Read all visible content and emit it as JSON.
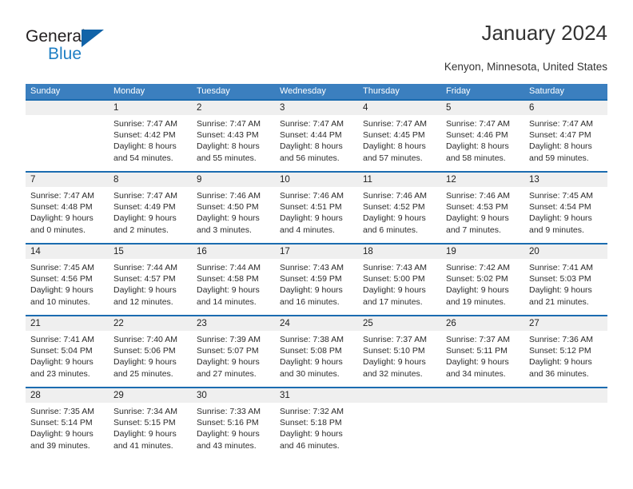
{
  "brand": {
    "name_part1": "General",
    "name_part2": "Blue"
  },
  "header": {
    "title": "January 2024",
    "location": "Kenyon, Minnesota, United States"
  },
  "colors": {
    "header_blue": "#3b7fbf",
    "separator_blue": "#1b6cb0",
    "date_band_gray": "#efefef",
    "brand_blue": "#1f7fc4",
    "logo_triangle": "#1163a8",
    "text": "#2b2b2b"
  },
  "calendar": {
    "day_names": [
      "Sunday",
      "Monday",
      "Tuesday",
      "Wednesday",
      "Thursday",
      "Friday",
      "Saturday"
    ],
    "weeks": [
      [
        {
          "day": "",
          "lines": []
        },
        {
          "day": "1",
          "lines": [
            "Sunrise: 7:47 AM",
            "Sunset: 4:42 PM",
            "Daylight: 8 hours",
            "and 54 minutes."
          ]
        },
        {
          "day": "2",
          "lines": [
            "Sunrise: 7:47 AM",
            "Sunset: 4:43 PM",
            "Daylight: 8 hours",
            "and 55 minutes."
          ]
        },
        {
          "day": "3",
          "lines": [
            "Sunrise: 7:47 AM",
            "Sunset: 4:44 PM",
            "Daylight: 8 hours",
            "and 56 minutes."
          ]
        },
        {
          "day": "4",
          "lines": [
            "Sunrise: 7:47 AM",
            "Sunset: 4:45 PM",
            "Daylight: 8 hours",
            "and 57 minutes."
          ]
        },
        {
          "day": "5",
          "lines": [
            "Sunrise: 7:47 AM",
            "Sunset: 4:46 PM",
            "Daylight: 8 hours",
            "and 58 minutes."
          ]
        },
        {
          "day": "6",
          "lines": [
            "Sunrise: 7:47 AM",
            "Sunset: 4:47 PM",
            "Daylight: 8 hours",
            "and 59 minutes."
          ]
        }
      ],
      [
        {
          "day": "7",
          "lines": [
            "Sunrise: 7:47 AM",
            "Sunset: 4:48 PM",
            "Daylight: 9 hours",
            "and 0 minutes."
          ]
        },
        {
          "day": "8",
          "lines": [
            "Sunrise: 7:47 AM",
            "Sunset: 4:49 PM",
            "Daylight: 9 hours",
            "and 2 minutes."
          ]
        },
        {
          "day": "9",
          "lines": [
            "Sunrise: 7:46 AM",
            "Sunset: 4:50 PM",
            "Daylight: 9 hours",
            "and 3 minutes."
          ]
        },
        {
          "day": "10",
          "lines": [
            "Sunrise: 7:46 AM",
            "Sunset: 4:51 PM",
            "Daylight: 9 hours",
            "and 4 minutes."
          ]
        },
        {
          "day": "11",
          "lines": [
            "Sunrise: 7:46 AM",
            "Sunset: 4:52 PM",
            "Daylight: 9 hours",
            "and 6 minutes."
          ]
        },
        {
          "day": "12",
          "lines": [
            "Sunrise: 7:46 AM",
            "Sunset: 4:53 PM",
            "Daylight: 9 hours",
            "and 7 minutes."
          ]
        },
        {
          "day": "13",
          "lines": [
            "Sunrise: 7:45 AM",
            "Sunset: 4:54 PM",
            "Daylight: 9 hours",
            "and 9 minutes."
          ]
        }
      ],
      [
        {
          "day": "14",
          "lines": [
            "Sunrise: 7:45 AM",
            "Sunset: 4:56 PM",
            "Daylight: 9 hours",
            "and 10 minutes."
          ]
        },
        {
          "day": "15",
          "lines": [
            "Sunrise: 7:44 AM",
            "Sunset: 4:57 PM",
            "Daylight: 9 hours",
            "and 12 minutes."
          ]
        },
        {
          "day": "16",
          "lines": [
            "Sunrise: 7:44 AM",
            "Sunset: 4:58 PM",
            "Daylight: 9 hours",
            "and 14 minutes."
          ]
        },
        {
          "day": "17",
          "lines": [
            "Sunrise: 7:43 AM",
            "Sunset: 4:59 PM",
            "Daylight: 9 hours",
            "and 16 minutes."
          ]
        },
        {
          "day": "18",
          "lines": [
            "Sunrise: 7:43 AM",
            "Sunset: 5:00 PM",
            "Daylight: 9 hours",
            "and 17 minutes."
          ]
        },
        {
          "day": "19",
          "lines": [
            "Sunrise: 7:42 AM",
            "Sunset: 5:02 PM",
            "Daylight: 9 hours",
            "and 19 minutes."
          ]
        },
        {
          "day": "20",
          "lines": [
            "Sunrise: 7:41 AM",
            "Sunset: 5:03 PM",
            "Daylight: 9 hours",
            "and 21 minutes."
          ]
        }
      ],
      [
        {
          "day": "21",
          "lines": [
            "Sunrise: 7:41 AM",
            "Sunset: 5:04 PM",
            "Daylight: 9 hours",
            "and 23 minutes."
          ]
        },
        {
          "day": "22",
          "lines": [
            "Sunrise: 7:40 AM",
            "Sunset: 5:06 PM",
            "Daylight: 9 hours",
            "and 25 minutes."
          ]
        },
        {
          "day": "23",
          "lines": [
            "Sunrise: 7:39 AM",
            "Sunset: 5:07 PM",
            "Daylight: 9 hours",
            "and 27 minutes."
          ]
        },
        {
          "day": "24",
          "lines": [
            "Sunrise: 7:38 AM",
            "Sunset: 5:08 PM",
            "Daylight: 9 hours",
            "and 30 minutes."
          ]
        },
        {
          "day": "25",
          "lines": [
            "Sunrise: 7:37 AM",
            "Sunset: 5:10 PM",
            "Daylight: 9 hours",
            "and 32 minutes."
          ]
        },
        {
          "day": "26",
          "lines": [
            "Sunrise: 7:37 AM",
            "Sunset: 5:11 PM",
            "Daylight: 9 hours",
            "and 34 minutes."
          ]
        },
        {
          "day": "27",
          "lines": [
            "Sunrise: 7:36 AM",
            "Sunset: 5:12 PM",
            "Daylight: 9 hours",
            "and 36 minutes."
          ]
        }
      ],
      [
        {
          "day": "28",
          "lines": [
            "Sunrise: 7:35 AM",
            "Sunset: 5:14 PM",
            "Daylight: 9 hours",
            "and 39 minutes."
          ]
        },
        {
          "day": "29",
          "lines": [
            "Sunrise: 7:34 AM",
            "Sunset: 5:15 PM",
            "Daylight: 9 hours",
            "and 41 minutes."
          ]
        },
        {
          "day": "30",
          "lines": [
            "Sunrise: 7:33 AM",
            "Sunset: 5:16 PM",
            "Daylight: 9 hours",
            "and 43 minutes."
          ]
        },
        {
          "day": "31",
          "lines": [
            "Sunrise: 7:32 AM",
            "Sunset: 5:18 PM",
            "Daylight: 9 hours",
            "and 46 minutes."
          ]
        },
        {
          "day": "",
          "lines": []
        },
        {
          "day": "",
          "lines": []
        },
        {
          "day": "",
          "lines": []
        }
      ]
    ]
  }
}
